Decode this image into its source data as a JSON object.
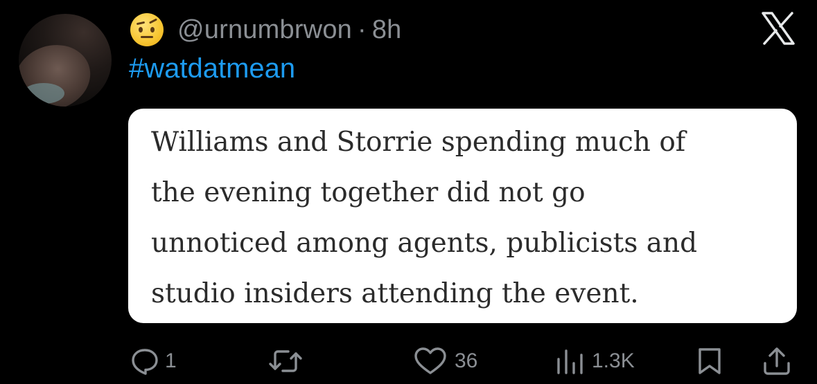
{
  "tweet": {
    "handle": "@urnumbrwon",
    "separator": "·",
    "time": "8h",
    "hashtag": "#watdatmean",
    "quote_lines": [
      "Williams and Storrie spending much of",
      "the evening together did not go",
      "unnoticed among agents, publicists and",
      "studio insiders attending the event."
    ]
  },
  "actions": {
    "replies": "1",
    "likes": "36",
    "views": "1.3K"
  },
  "icons": {
    "emoji": "raised-eyebrow-emoji",
    "brand": "x-logo-icon"
  },
  "colors": {
    "background": "#000000",
    "accent": "#1d9bf0",
    "muted": "#8b8f94",
    "card": "#ffffff"
  }
}
